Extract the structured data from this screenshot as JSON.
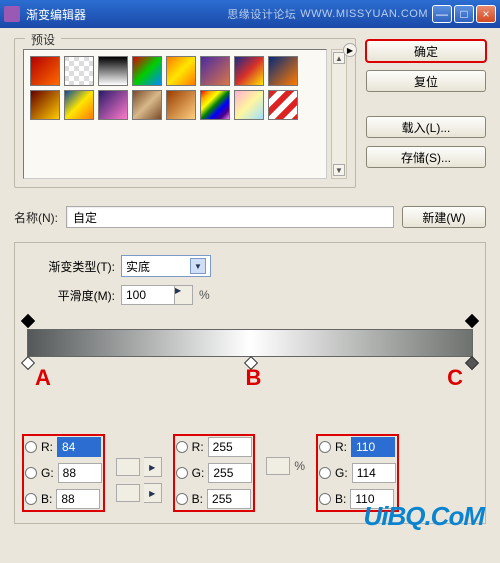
{
  "title": "渐变编辑器",
  "watermark_site": "思缘设计论坛",
  "watermark_url": "WWW.MISSYUAN.COM",
  "win": {
    "min": "—",
    "max": "□",
    "close": "×"
  },
  "presets": {
    "legend": "预设"
  },
  "buttons": {
    "ok": "确定",
    "reset": "复位",
    "load": "载入(L)...",
    "save": "存储(S)...",
    "new": "新建(W)"
  },
  "name": {
    "label": "名称(N):",
    "value": "自定"
  },
  "gradient": {
    "type_label": "渐变类型(T):",
    "type_value": "实底",
    "smooth_label": "平滑度(M):",
    "smooth_value": "100",
    "smooth_unit": "%"
  },
  "stops_labels": {
    "A": "A",
    "B": "B",
    "C": "C"
  },
  "rgb": {
    "labels": {
      "R": "R:",
      "G": "G:",
      "B": "B:",
      "pct": "%"
    },
    "A": {
      "R": "84",
      "G": "88",
      "B": "88"
    },
    "B": {
      "R": "255",
      "G": "255",
      "B": "255"
    },
    "C": {
      "R": "110",
      "G": "114",
      "B": "110"
    }
  },
  "chart_data": {
    "type": "gradient",
    "stops": [
      {
        "label": "A",
        "pos_pct": 0,
        "color": {
          "r": 84,
          "g": 88,
          "b": 88
        }
      },
      {
        "label": "B",
        "pos_pct": 50,
        "color": {
          "r": 255,
          "g": 255,
          "b": 255
        }
      },
      {
        "label": "C",
        "pos_pct": 100,
        "color": {
          "r": 110,
          "g": 114,
          "b": 110
        }
      }
    ]
  },
  "footer": "UiBQ.CoM"
}
